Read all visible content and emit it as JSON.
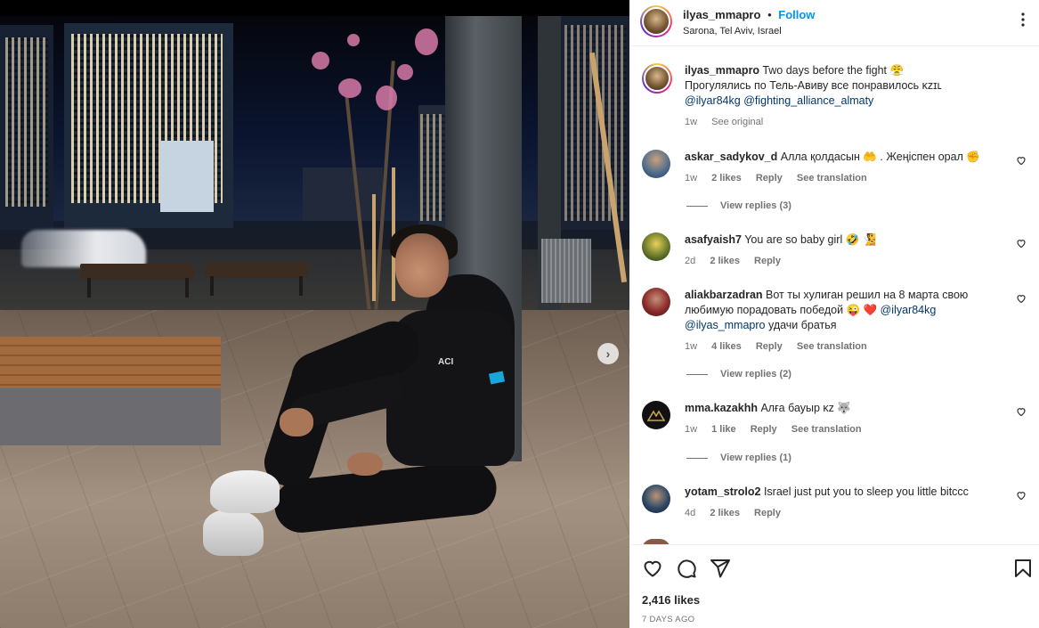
{
  "post": {
    "username": "ilyas_mmapro",
    "separator": "•",
    "follow_label": "Follow",
    "location": "Sarona, Tel Aviv, Israel",
    "more_label": "•••",
    "carousel_next": "›"
  },
  "caption": {
    "username": "ilyas_mmapro",
    "text_line1": "Two days before the fight 😤",
    "text_line2": "Прогулялись по Тель-Авиву все понравилось ᴋᴢɪʟ",
    "mention1": "@ilyar84kg",
    "mention2": "@fighting_alliance_almaty",
    "time": "1w",
    "see_original": "See original"
  },
  "comments": [
    {
      "username": "askar_sadykov_d",
      "text": "Алла қолдасын 🤲 . Жеңіспен орал ✊",
      "time": "1w",
      "likes": "2 likes",
      "reply": "Reply",
      "translation": "See translation",
      "view_replies": "View replies (3)"
    },
    {
      "username": "asafyaish7",
      "text": "You are so baby girl 🤣 🧏",
      "time": "2d",
      "likes": "2 likes",
      "reply": "Reply"
    },
    {
      "username": "aliakbarzadran",
      "text": "Вот ты хулиган решил на 8 марта свою любимую порадовать победой 😜 ❤️",
      "mention1": "@ilyar84kg",
      "mention2": "@ilyas_mmapro",
      "text_end": "удачи братья",
      "time": "1w",
      "likes": "4 likes",
      "reply": "Reply",
      "translation": "See translation",
      "view_replies": "View replies (2)"
    },
    {
      "username": "mma.kazakhh",
      "text": "Алға бауыр ᴋᴢ 🐺",
      "time": "1w",
      "likes": "1 like",
      "reply": "Reply",
      "translation": "See translation",
      "view_replies": "View replies (1)"
    },
    {
      "username": "yotam_strolo2",
      "text": "Israel just put you to sleep you little bitccc",
      "time": "4d",
      "likes": "2 likes",
      "reply": "Reply"
    }
  ],
  "footer": {
    "likes": "2,416 likes",
    "time_ago": "7 DAYS AGO"
  },
  "photo": {
    "hoodie_logo": "ACI"
  },
  "icons": {
    "like": "heart-icon",
    "comment": "comment-icon",
    "share": "send-icon",
    "save": "bookmark-icon"
  },
  "colors": {
    "follow_blue": "#0095f6",
    "mention": "#00376b",
    "muted": "#737373"
  }
}
